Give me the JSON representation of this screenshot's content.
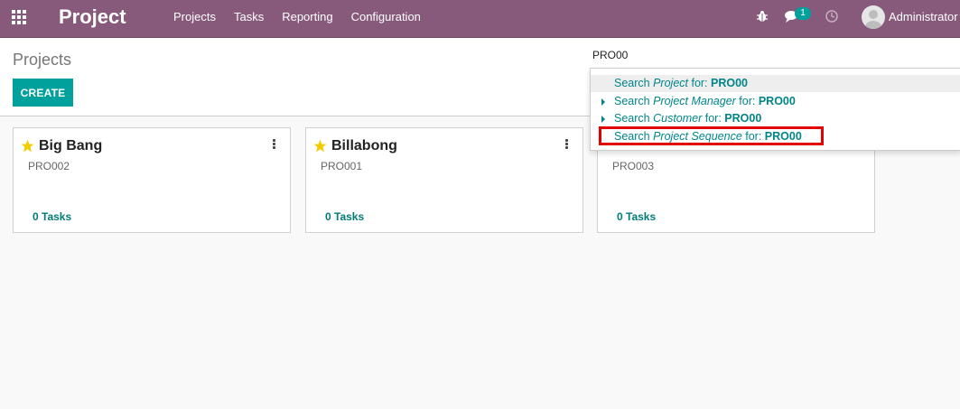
{
  "navbar": {
    "app_title": "Project",
    "menu": [
      "Projects",
      "Tasks",
      "Reporting",
      "Configuration"
    ],
    "chat_badge": "1",
    "user_name": "Administrator",
    "icons": [
      "apps-grid-icon",
      "bug-icon",
      "chat-icon",
      "clock-icon",
      "avatar"
    ]
  },
  "control_panel": {
    "breadcrumb": "Projects",
    "create_label": "CREATE",
    "search_value": "PRO00"
  },
  "autocomplete": {
    "items": [
      {
        "prefix": "Search ",
        "field": "Project",
        "middle": " for: ",
        "term": "PRO00"
      },
      {
        "prefix": "Search ",
        "field": "Project Manager",
        "middle": " for: ",
        "term": "PRO00"
      },
      {
        "prefix": "Search ",
        "field": "Customer",
        "middle": " for: ",
        "term": "PRO00"
      },
      {
        "prefix": "Search ",
        "field": "Project Sequence",
        "middle": " for: ",
        "term": "PRO00"
      }
    ]
  },
  "cards": [
    {
      "name": "Big Bang",
      "code": "PRO002",
      "tasks": "0 Tasks"
    },
    {
      "name": "Billabong",
      "code": "PRO001",
      "tasks": "0 Tasks"
    },
    {
      "name": "",
      "code": "PRO003",
      "tasks": "0 Tasks"
    }
  ],
  "colors": {
    "navbar": "#875a7b",
    "accent": "#00a09d",
    "highlight_border": "#e00000",
    "star": "#f3cc00"
  }
}
